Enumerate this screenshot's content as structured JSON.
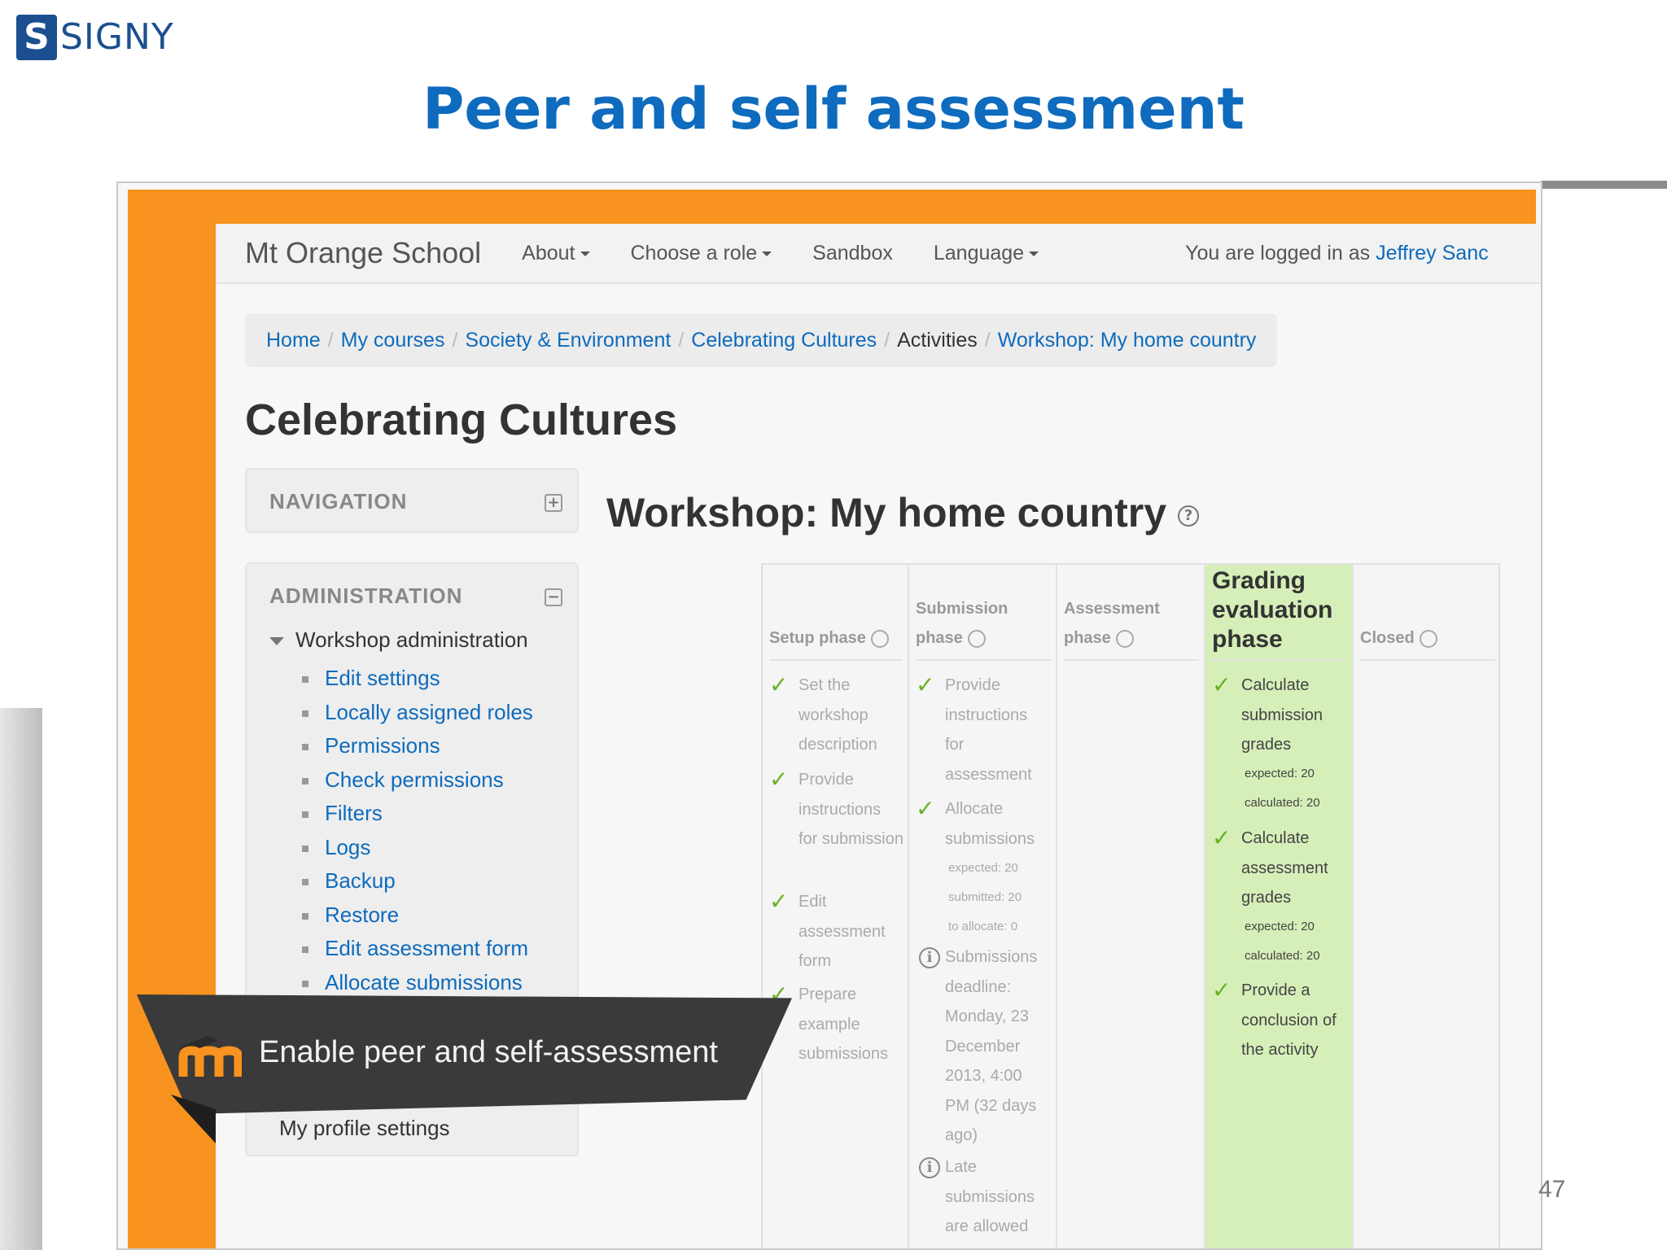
{
  "slide": {
    "logo_letter": "S",
    "logo_text": "SIGNY",
    "title": "Peer and self assessment",
    "page_number": "47",
    "title_color": "#0e6bbd",
    "accent_color": "#f7931e"
  },
  "navbar": {
    "brand": "Mt Orange School",
    "items": [
      "About",
      "Choose a role",
      "Sandbox",
      "Language"
    ],
    "logged_prefix": "You are logged in as",
    "logged_user": "Jeffrey Sanc"
  },
  "breadcrumb": [
    "Home",
    "My courses",
    "Society & Environment",
    "Celebrating Cultures",
    "Activities",
    "Workshop: My home country"
  ],
  "course_title": "Celebrating Cultures",
  "navigation_block": {
    "title": "NAVIGATION"
  },
  "administration_block": {
    "title": "ADMINISTRATION",
    "parent": "Workshop administration",
    "items": [
      "Edit settings",
      "Locally assigned roles",
      "Permissions",
      "Check permissions",
      "Filters",
      "Logs",
      "Backup",
      "Restore",
      "Edit assessment form",
      "Allocate submissions"
    ],
    "profile_settings": "My profile settings"
  },
  "workshop_title": "Workshop: My home country",
  "phases": {
    "setup": {
      "title": "Setup phase",
      "tasks": [
        "Set the workshop description",
        "Provide instructions for submission",
        "Edit assessment form",
        "Prepare example submissions"
      ]
    },
    "submission": {
      "title_line1": "Submission",
      "title_line2": "phase",
      "task_instructions": "Provide instructions for assessment",
      "task_allocate": "Allocate submissions",
      "allocate_details": [
        "expected: 20",
        "submitted: 20",
        "to allocate: 0"
      ],
      "deadline": "Submissions deadline: Monday, 23 December 2013, 4:00 PM (32 days ago)",
      "late": "Late submissions are allowed"
    },
    "assessment": {
      "title_line1": "Assessment",
      "title_line2": "phase"
    },
    "grading": {
      "title": "Grading evaluation phase",
      "task_submission_grades": "Calculate submission grades",
      "submission_details": [
        "expected: 20",
        "calculated: 20"
      ],
      "task_assessment_grades": "Calculate assessment grades",
      "assessment_details": [
        "expected: 20",
        "calculated: 20"
      ],
      "task_conclusion": "Provide a conclusion of the activity"
    },
    "closed": {
      "title": "Closed"
    }
  },
  "banner": {
    "text": "Enable peer and self-assessment"
  }
}
